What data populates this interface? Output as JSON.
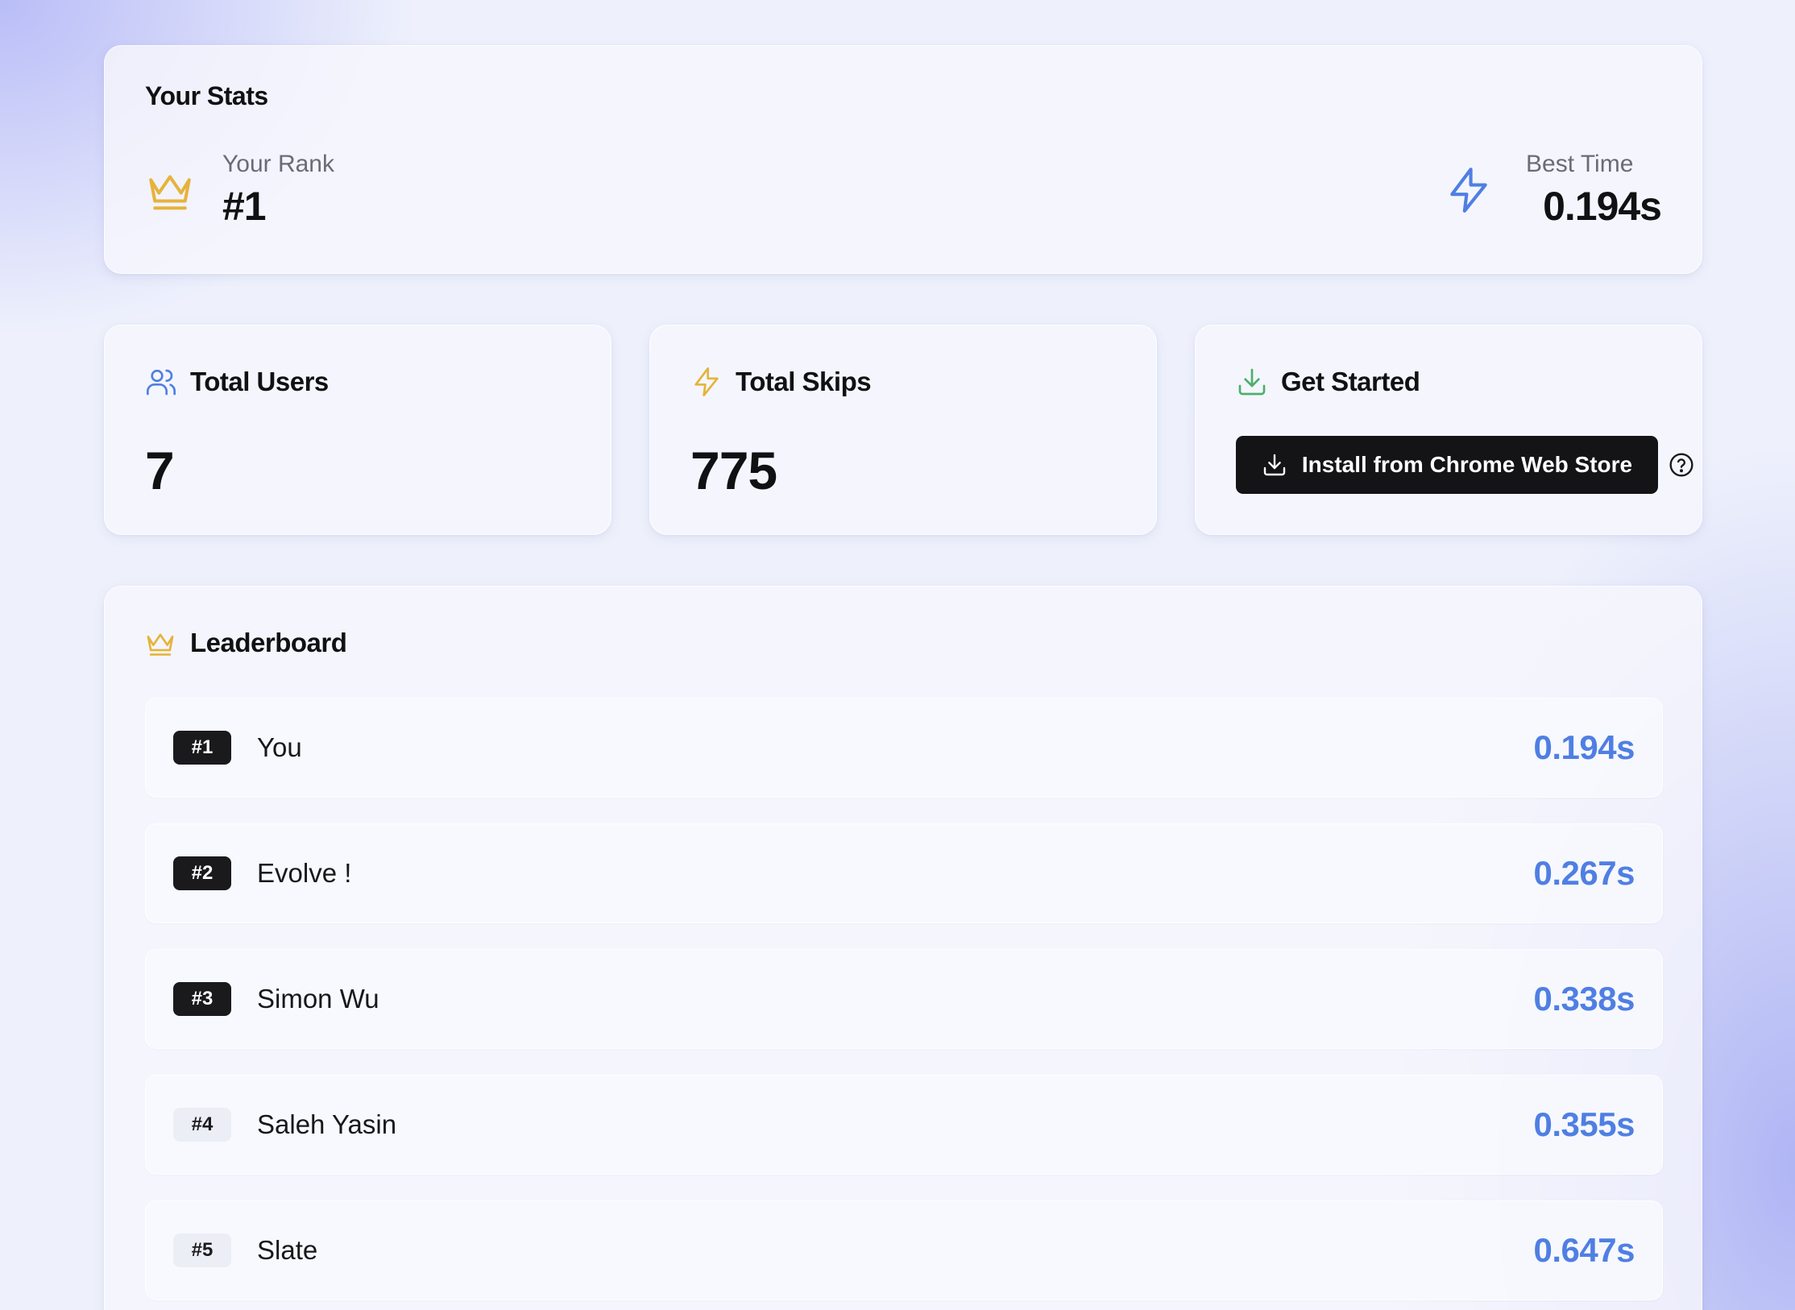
{
  "stats": {
    "title": "Your Stats",
    "rank_label": "Your Rank",
    "rank_value": "#1",
    "best_time_label": "Best Time",
    "best_time_value": "0.194s"
  },
  "total_users": {
    "title": "Total Users",
    "value": "7"
  },
  "total_skips": {
    "title": "Total Skips",
    "value": "775"
  },
  "get_started": {
    "title": "Get Started",
    "install_label": "Install from Chrome Web Store"
  },
  "leaderboard": {
    "title": "Leaderboard",
    "rows": [
      {
        "rank": "#1",
        "name": "You",
        "time": "0.194s",
        "badge_style": "dark"
      },
      {
        "rank": "#2",
        "name": "Evolve !",
        "time": "0.267s",
        "badge_style": "dark"
      },
      {
        "rank": "#3",
        "name": "Simon Wu",
        "time": "0.338s",
        "badge_style": "dark"
      },
      {
        "rank": "#4",
        "name": "Saleh Yasin",
        "time": "0.355s",
        "badge_style": "light"
      },
      {
        "rank": "#5",
        "name": "Slate",
        "time": "0.647s",
        "badge_style": "light"
      }
    ]
  },
  "icons": {
    "rank": "crown-icon",
    "best_time": "lightning-icon",
    "users": "users-icon",
    "skips": "lightning-icon",
    "get_started": "download-icon",
    "install_button": "download-icon",
    "help": "help-circle-icon",
    "leaderboard": "crown-icon"
  },
  "colors": {
    "crown": "#e6b33a",
    "lightning_best": "#4f7fe3",
    "lightning_skips": "#e6b33a",
    "users_icon": "#4f7fe3",
    "download_icon": "#4caf6a",
    "time_text": "#4f7fe3",
    "button_bg": "#141416"
  }
}
